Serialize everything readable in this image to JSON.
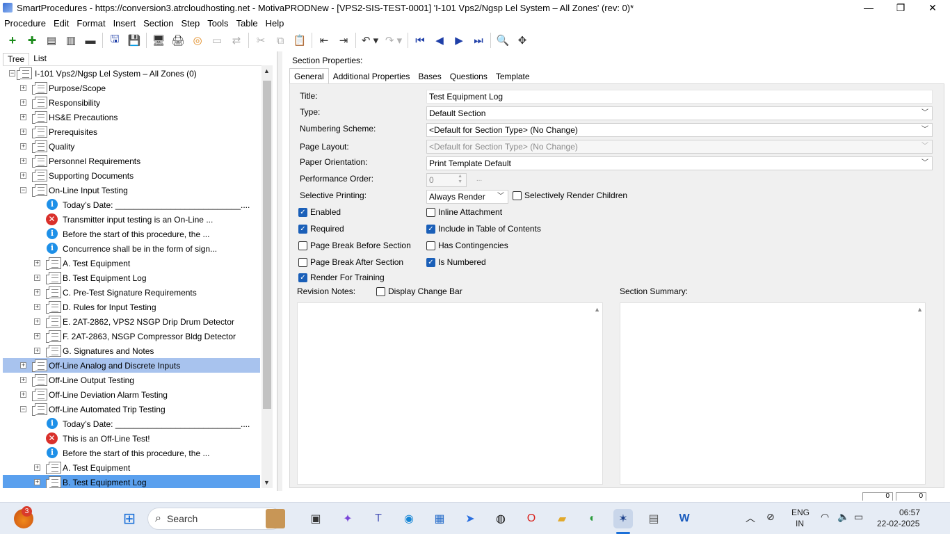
{
  "window": {
    "title": "SmartProcedures - https://conversion3.atrcloudhosting.net - MotivaPRODNew - [VPS2-SIS-TEST-0001] 'I-101 Vps2/Ngsp Lel System – All Zones' (rev: 0)*",
    "minimize": "—",
    "maximize": "❐",
    "close": "✕"
  },
  "menu": [
    "Procedure",
    "Edit",
    "Format",
    "Insert",
    "Section",
    "Step",
    "Tools",
    "Table",
    "Help"
  ],
  "left_tabs": {
    "tree": "Tree",
    "list": "List"
  },
  "tree": [
    {
      "label": "I-101 Vps2/Ngsp Lel System – All Zones (0)",
      "type": "doc",
      "level": 0,
      "exp": "−"
    },
    {
      "label": "Purpose/Scope",
      "type": "doc",
      "level": 1,
      "exp": "+"
    },
    {
      "label": "Responsibility",
      "type": "doc",
      "level": 1,
      "exp": "+"
    },
    {
      "label": "HS&E Precautions",
      "type": "doc",
      "level": 1,
      "exp": "+"
    },
    {
      "label": "Prerequisites",
      "type": "doc",
      "level": 1,
      "exp": "+"
    },
    {
      "label": "Quality",
      "type": "doc",
      "level": 1,
      "exp": "+"
    },
    {
      "label": "Personnel Requirements",
      "type": "doc",
      "level": 1,
      "exp": "+"
    },
    {
      "label": "Supporting Documents",
      "type": "doc",
      "level": 1,
      "exp": "+"
    },
    {
      "label": "On-Line Input Testing",
      "type": "doc",
      "level": 1,
      "exp": "−"
    },
    {
      "label": "Today’s Date: ___________________________....",
      "type": "info",
      "level": 2
    },
    {
      "label": "Transmitter input testing is an On-Line ...",
      "type": "err",
      "level": 2
    },
    {
      "label": "Before the start of this procedure, the ...",
      "type": "info",
      "level": 2
    },
    {
      "label": "Concurrence shall be in the form of sign...",
      "type": "info",
      "level": 2
    },
    {
      "label": "A. Test Equipment",
      "type": "doc",
      "level": 2,
      "exp": "+"
    },
    {
      "label": "B. Test Equipment Log",
      "type": "doc",
      "level": 2,
      "exp": "+"
    },
    {
      "label": "C. Pre-Test Signature Requirements",
      "type": "doc",
      "level": 2,
      "exp": "+"
    },
    {
      "label": "D. Rules for Input Testing",
      "type": "doc",
      "level": 2,
      "exp": "+"
    },
    {
      "label": "E. 2AT-2862, VPS2 NSGP Drip Drum Detector",
      "type": "doc",
      "level": 2,
      "exp": "+"
    },
    {
      "label": "F. 2AT-2863, NSGP Compressor Bldg Detector",
      "type": "doc",
      "level": 2,
      "exp": "+"
    },
    {
      "label": "G. Signatures and Notes",
      "type": "doc",
      "level": 2,
      "exp": "+"
    },
    {
      "label": "Off-Line Analog and Discrete Inputs",
      "type": "doc",
      "level": 1,
      "exp": "+",
      "sel": "light"
    },
    {
      "label": "Off-Line Output Testing",
      "type": "doc",
      "level": 1,
      "exp": "+"
    },
    {
      "label": "Off-Line Deviation Alarm Testing",
      "type": "doc",
      "level": 1,
      "exp": "+"
    },
    {
      "label": "Off-Line Automated Trip Testing",
      "type": "doc",
      "level": 1,
      "exp": "−"
    },
    {
      "label": "Today’s Date: ___________________________....",
      "type": "info",
      "level": 2
    },
    {
      "label": "This is an Off-Line Test!",
      "type": "err",
      "level": 2
    },
    {
      "label": "Before the start of this procedure, the ...",
      "type": "info",
      "level": 2
    },
    {
      "label": "A. Test Equipment",
      "type": "doc",
      "level": 2,
      "exp": "+"
    },
    {
      "label": "B. Test Equipment Log",
      "type": "doc",
      "level": 2,
      "exp": "+",
      "sel": "strong"
    }
  ],
  "right": {
    "header": "Section Properties:",
    "tabs": [
      "General",
      "Additional Properties",
      "Bases",
      "Questions",
      "Template"
    ],
    "fields": {
      "title_label": "Title:",
      "title_value": "Test Equipment Log",
      "type_label": "Type:",
      "type_value": "Default Section",
      "numbering_label": "Numbering Scheme:",
      "numbering_value": "<Default for Section Type> (No Change)",
      "layout_label": "Page Layout:",
      "layout_value": "<Default for Section Type> (No Change)",
      "orientation_label": "Paper Orientation:",
      "orientation_value": "Print Template Default",
      "perf_label": "Performance Order:",
      "perf_value": "0",
      "perf_button": "...",
      "selective_label": "Selective Printing:",
      "selective_value": "Always Render"
    },
    "checkboxes": {
      "selectively_render_children": {
        "label": "Selectively Render Children",
        "checked": false
      },
      "enabled": {
        "label": "Enabled",
        "checked": true
      },
      "inline_attachment": {
        "label": "Inline Attachment",
        "checked": false
      },
      "required": {
        "label": "Required",
        "checked": true
      },
      "include_toc": {
        "label": "Include in Table of Contents",
        "checked": true
      },
      "page_break_before": {
        "label": "Page Break Before Section",
        "checked": false
      },
      "has_contingencies": {
        "label": "Has Contingencies",
        "checked": false
      },
      "page_break_after": {
        "label": "Page Break After Section",
        "checked": false
      },
      "is_numbered": {
        "label": "Is Numbered",
        "checked": true
      },
      "render_training": {
        "label": "Render For Training",
        "checked": true
      },
      "display_change_bar": {
        "label": "Display Change Bar",
        "checked": false
      }
    },
    "revision_notes_label": "Revision Notes:",
    "section_summary_label": "Section Summary:"
  },
  "statusbar": {
    "a": "0",
    "b": "0"
  },
  "taskbar": {
    "search": "Search",
    "badge": "3",
    "lang": "ENG",
    "region": "IN",
    "time": "06:57",
    "date": "22-02-2025"
  },
  "colors": {
    "selection_light": "#a8c3ee",
    "selection_strong": "#5aa0ee",
    "checkbox": "#1a5fb8",
    "error": "#d9302b",
    "info": "#1e90e8"
  }
}
